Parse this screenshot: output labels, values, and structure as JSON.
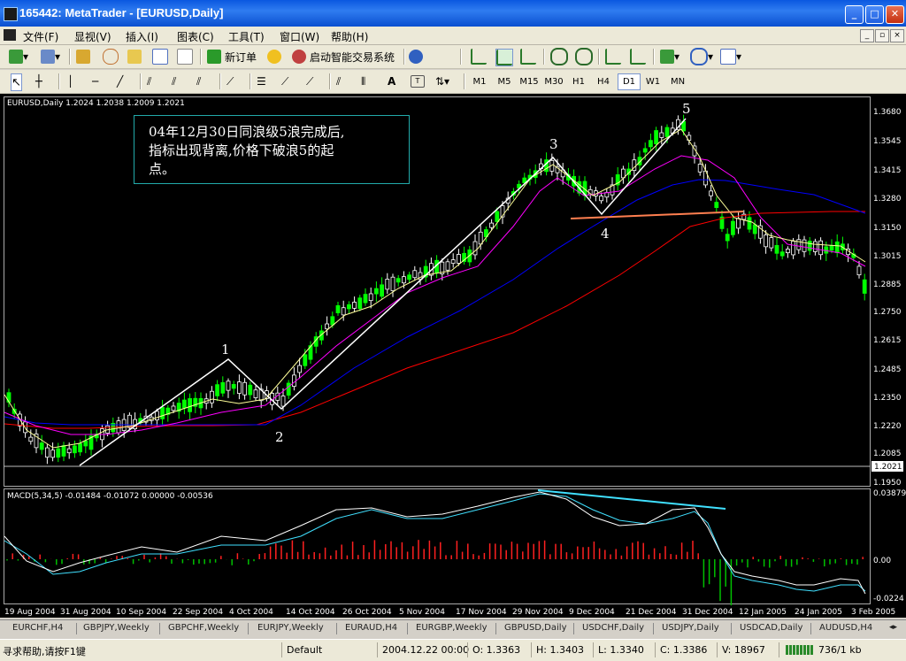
{
  "window": {
    "title": "165442: MetaTrader - [EURUSD,Daily]"
  },
  "menu": {
    "items": [
      "文件(F)",
      "显视(V)",
      "插入(I)",
      "图表(C)",
      "工具(T)",
      "窗口(W)",
      "帮助(H)"
    ]
  },
  "toolbar1": {
    "new_order": "新订单",
    "expert_advisors": "启动智能交易系统"
  },
  "toolbar2": {
    "timeframes": [
      "M1",
      "M5",
      "M15",
      "M30",
      "H1",
      "H4",
      "D1",
      "W1",
      "MN"
    ],
    "active": "D1"
  },
  "chart": {
    "header": "EURUSD,Daily  1.2024 1.2038 1.2009 1.2021",
    "price_labels": [
      "1.3680",
      "1.3545",
      "1.3415",
      "1.3280",
      "1.3150",
      "1.3015",
      "1.2885",
      "1.2750",
      "1.2615",
      "1.2485",
      "1.2350",
      "1.2220",
      "1.2085",
      "1.1950"
    ],
    "current_price": "1.2021",
    "annotation": [
      "04年12月30日同浪级5浪完成后,",
      "指标出现背离,价格下破浪5的起",
      "点。"
    ],
    "wave_labels": [
      "1",
      "2",
      "3",
      "4",
      "5"
    ],
    "colors": {
      "up_candle": "#00ff00",
      "down_candle": "#ffffff",
      "ma_fast": "#ffff99",
      "ma_mid": "#ff00ff",
      "ma_slow": "#0000ff",
      "ma_long": "#ff0000",
      "wave_line": "#ffffff",
      "neckline": "#ff7f50",
      "divergence": "#40e0ff"
    }
  },
  "macd": {
    "header": "MACD(5,34,5) -0.01484 -0.01072 0.00000 -0.00536",
    "scale_labels": [
      "0.03879",
      "0.00",
      "-0.0224"
    ]
  },
  "date_labels": [
    "19 Aug 2004",
    "31 Aug 2004",
    "10 Sep 2004",
    "22 Sep 2004",
    "4 Oct 2004",
    "14 Oct 2004",
    "26 Oct 2004",
    "5 Nov 2004",
    "17 Nov 2004",
    "29 Nov 2004",
    "9 Dec 2004",
    "21 Dec 2004",
    "31 Dec 2004",
    "12 Jan 2005",
    "24 Jan 2005",
    "3 Feb 2005"
  ],
  "symbol_tabs": [
    "EURCHF,H4",
    "GBPJPY,Weekly",
    "GBPCHF,Weekly",
    "EURJPY,Weekly",
    "EURAUD,H4",
    "EURGBP,Weekly",
    "GBPUSD,Daily",
    "USDCHF,Daily",
    "USDJPY,Daily",
    "USDCAD,Daily",
    "AUDUSD,H4"
  ],
  "status": {
    "help": "寻求帮助,请按F1键",
    "profile": "Default",
    "datetime": "2004.12.22 00:00",
    "open": "O: 1.3363",
    "high": "H: 1.3403",
    "low": "L: 1.3340",
    "close": "C: 1.3386",
    "volume": "V: 18967",
    "traffic": "736/1 kb"
  }
}
